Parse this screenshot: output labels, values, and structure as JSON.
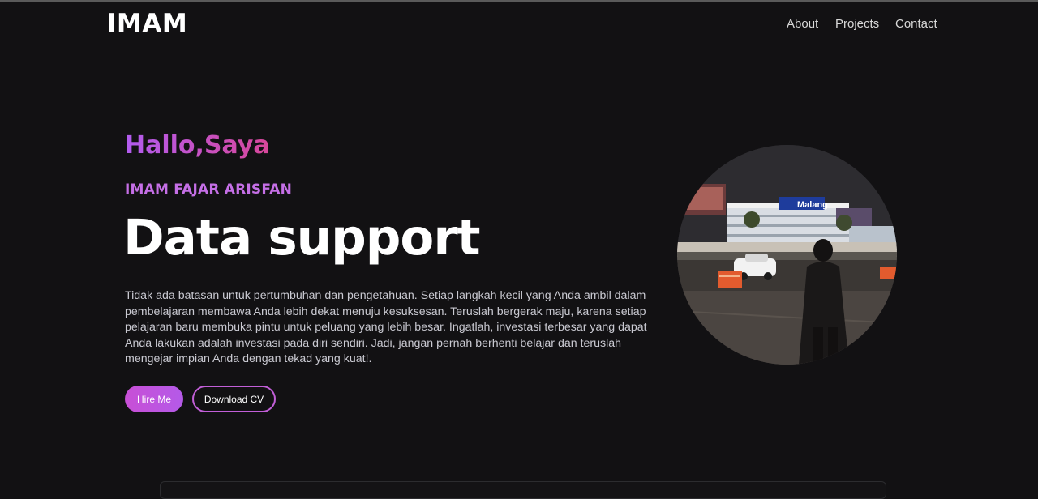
{
  "header": {
    "logo": "IMAM",
    "nav": [
      "About",
      "Projects",
      "Contact"
    ]
  },
  "hero": {
    "greeting": "Hallo,Saya",
    "name": "IMAM FAJAR ARISFAN",
    "role": "Data support",
    "description": "Tidak ada batasan untuk pertumbuhan dan pengetahuan. Setiap langkah kecil yang Anda ambil dalam pembelajaran membawa Anda lebih dekat menuju kesuksesan. Teruslah bergerak maju, karena setiap pelajaran baru membuka pintu untuk peluang yang lebih besar. Ingatlah, investasi terbesar yang dapat Anda lakukan adalah investasi pada diri sendiri. Jadi, jangan pernah berhenti belajar dan teruslah mengejar impian Anda dengan tekad yang kuat!.",
    "hire_label": "Hire Me",
    "cv_label": "Download CV",
    "photo_sign": "Malang"
  },
  "colors": {
    "background": "#121113",
    "accent_purple": "#b25cf0",
    "accent_pink": "#d8479a"
  }
}
